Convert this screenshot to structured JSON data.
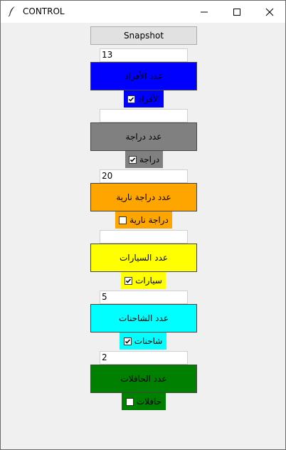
{
  "window": {
    "title": "CONTROL"
  },
  "snapshot_label": "Snapshot",
  "rows": [
    {
      "value": "13",
      "button_label": "عدد الأفراد",
      "check_label": "الأفراد",
      "checked": true,
      "color": "#0000ff"
    },
    {
      "value": "",
      "button_label": "عدد دراجة",
      "check_label": "دراجة",
      "checked": true,
      "color": "#808080"
    },
    {
      "value": "20",
      "button_label": "عدد دراجة نارية",
      "check_label": "دراجة نارية",
      "checked": false,
      "color": "#ffa500"
    },
    {
      "value": "",
      "button_label": "عدد السيارات",
      "check_label": "سيارات",
      "checked": true,
      "color": "#ffff00"
    },
    {
      "value": "5",
      "button_label": "عدد الشاحنات",
      "check_label": "شاحنات",
      "checked": true,
      "color": "#00ffff"
    },
    {
      "value": "2",
      "button_label": "عدد الحافلات",
      "check_label": "حافلات",
      "checked": false,
      "color": "#008000"
    }
  ]
}
